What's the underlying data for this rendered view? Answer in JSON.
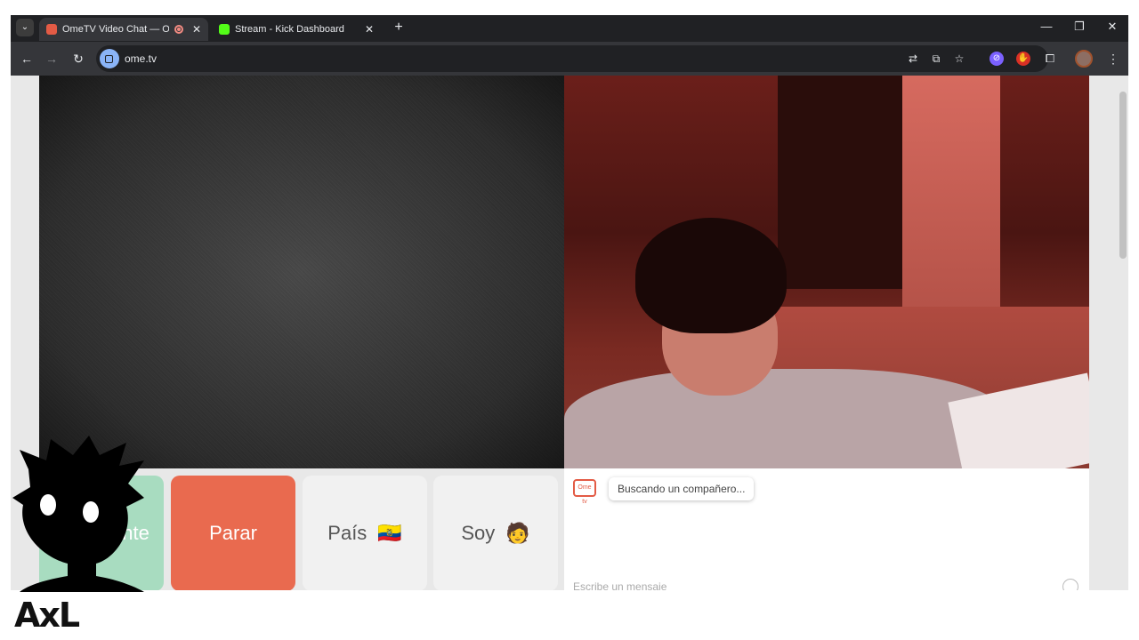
{
  "browser": {
    "tabs": [
      {
        "title": "OmeTV Video Chat — Ome",
        "favicon_color": "#e35b45",
        "recording": true,
        "active": true
      },
      {
        "title": "Stream - Kick Dashboard",
        "favicon_color": "#53fc18",
        "active": false
      }
    ],
    "close_glyph": "✕",
    "new_tab_glyph": "+",
    "tab_search_glyph": "⌄",
    "window_controls": {
      "minimize": "—",
      "restore": "❐",
      "close": "✕"
    },
    "nav": {
      "back": "←",
      "forward": "→",
      "reload": "↻"
    },
    "url": "ome.tv",
    "toolbar_icons": [
      "translate-icon",
      "install-app-icon",
      "bookmark-star-icon"
    ],
    "extension_icons": [
      "compass-extension-icon",
      "adblock-extension-icon",
      "extensions-puzzle-icon"
    ],
    "menu_glyph": "⋮"
  },
  "controls": {
    "next_label": "Siguiente",
    "next_visible_label": "iente",
    "stop_label": "Parar",
    "country_label": "País",
    "country_emoji": "🇪🇨",
    "gender_label": "Soy",
    "gender_emoji": "🧑"
  },
  "chat": {
    "logo_text": "Ome tv",
    "status_message": "Buscando un compañero...",
    "input_placeholder": "Escribe un mensaje"
  },
  "overlay": {
    "brand_text": "AxL"
  },
  "colors": {
    "next_button": "#a8dcc0",
    "stop_button": "#e96a4f",
    "neutral_button": "#f1f1f1",
    "ometv_accent": "#e35b45",
    "kick_green": "#53fc18"
  }
}
